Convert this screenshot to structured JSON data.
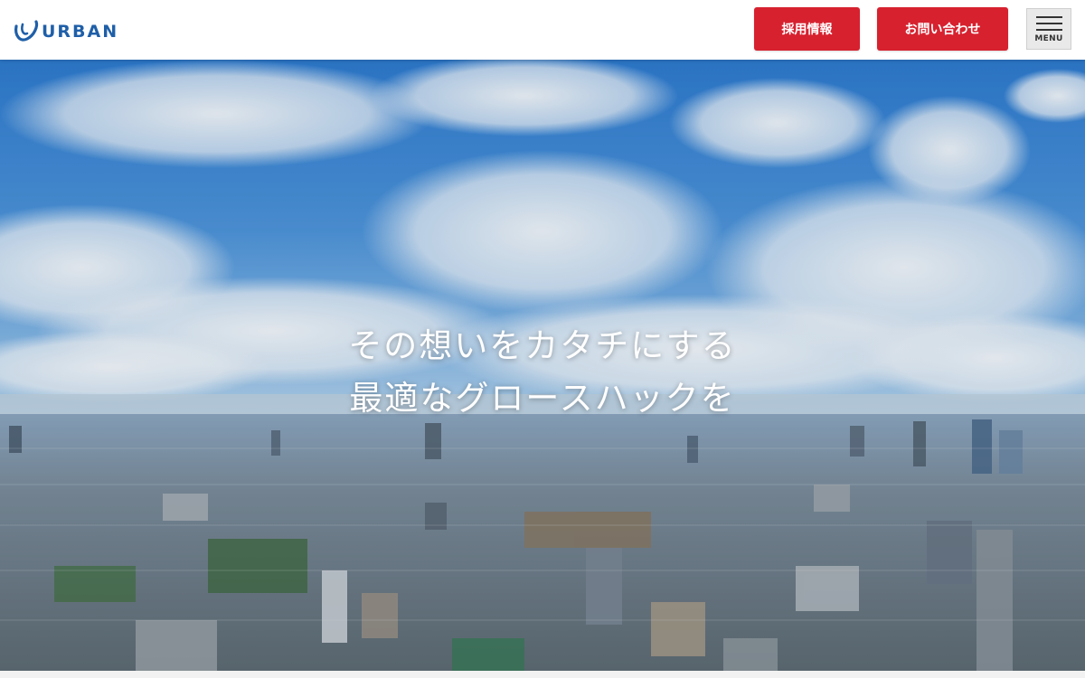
{
  "header": {
    "logo_text": "URBAN",
    "recruit_label": "採用情報",
    "contact_label": "お問い合わせ",
    "menu_label": "MENU"
  },
  "hero": {
    "line1": "その想いをカタチにする",
    "line2": "最適なグロースハックを"
  },
  "colors": {
    "brand_blue": "#1f5fa8",
    "button_red": "#d7212f"
  },
  "icons": {
    "logo": "urban-logo-icon",
    "menu": "hamburger-icon"
  }
}
